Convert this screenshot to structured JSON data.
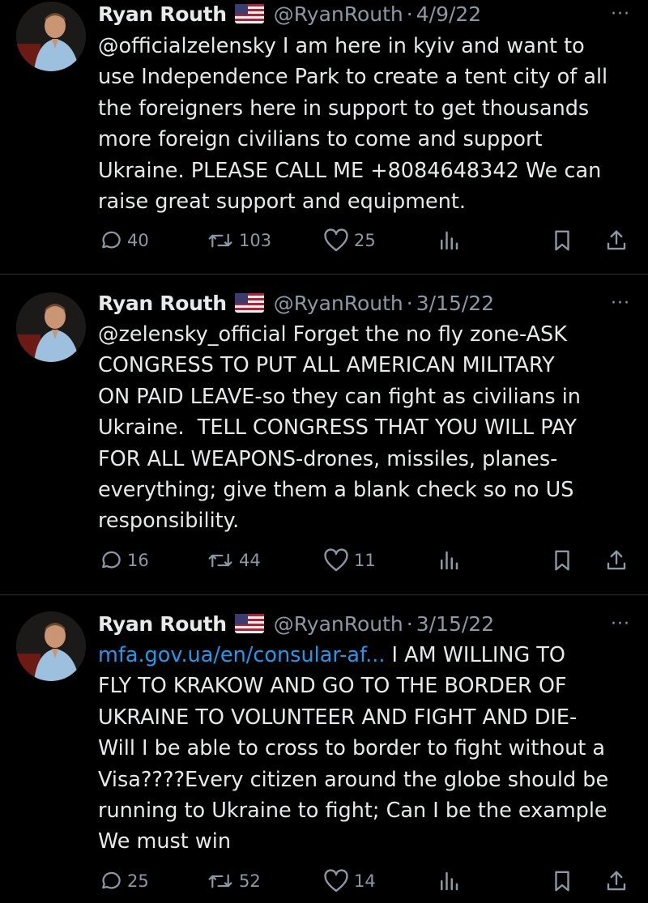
{
  "colors": {
    "background": "#000000",
    "text": "#e7e9ea",
    "muted": "#8b98a5",
    "link": "#1d9bf0",
    "divider": "#2f3336"
  },
  "icons": {
    "more": "more-icon",
    "reply": "reply-icon",
    "retweet": "retweet-icon",
    "like": "heart-icon",
    "views": "views-icon",
    "bookmark": "bookmark-icon",
    "share": "share-icon",
    "flag": "us-flag-icon"
  },
  "more_glyph": "···",
  "tweets": [
    {
      "name": "Ryan Routh",
      "handle": "@RyanRouth",
      "separator": "·",
      "date": "4/9/22",
      "link_text": "",
      "text": "@officialzelensky I am here in kyiv and want to\nuse Independence Park to create a tent city of all\nthe foreigners here in support to get thousands\nmore foreign civilians to come and support\nUkraine. PLEASE CALL ME +8084648342 We can\nraise great support and equipment.",
      "replies": "40",
      "retweets": "103",
      "likes": "25"
    },
    {
      "name": "Ryan Routh",
      "handle": "@RyanRouth",
      "separator": "·",
      "date": "3/15/22",
      "link_text": "",
      "text": "@zelensky_official Forget the no fly zone-ASK\nCONGRESS TO PUT ALL AMERICAN MILITARY\nON PAID LEAVE-so they can fight as civilians in\nUkraine.  TELL CONGRESS THAT YOU WILL PAY\nFOR ALL WEAPONS-drones, missiles, planes-\neverything; give them a blank check so no US\nresponsibility.",
      "replies": "16",
      "retweets": "44",
      "likes": "11"
    },
    {
      "name": "Ryan Routh",
      "handle": "@RyanRouth",
      "separator": "·",
      "date": "3/15/22",
      "link_text": "mfa.gov.ua/en/consular-af...",
      "text": " I AM WILLING TO\nFLY TO KRAKOW AND GO TO THE BORDER OF\nUKRAINE TO VOLUNTEER AND FIGHT AND DIE-\nWill I be able to cross to border to fight without a\nVisa????Every citizen around the globe should be\nrunning to Ukraine to fight; Can I be the example\nWe must win",
      "replies": "25",
      "retweets": "52",
      "likes": "14"
    }
  ]
}
